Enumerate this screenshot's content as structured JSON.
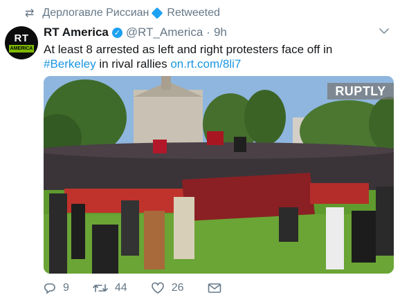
{
  "retweet_bar": {
    "icon": "retweet-icon",
    "retweeter_name": "Дерлогавле Pиссиан",
    "label": "Retweeted"
  },
  "tweet": {
    "author_name": "RT America",
    "handle": "@RT_America",
    "separator": "·",
    "time": "9h",
    "text_line1": "At least 8 arrested as left and right protesters face off in",
    "hashtag": "#Berkeley",
    "text_mid": " in rival rallies ",
    "link": "on.rt.com/8li7"
  },
  "avatar": {
    "logo_text": "RT",
    "logo_sub": "AMERICA"
  },
  "media": {
    "watermark": "RUPTLY"
  },
  "actions": {
    "reply_count": "9",
    "retweet_count": "44",
    "like_count": "26"
  },
  "colors": {
    "link": "#1b95e0",
    "muted": "#657786",
    "verified": "#1da1f2"
  }
}
